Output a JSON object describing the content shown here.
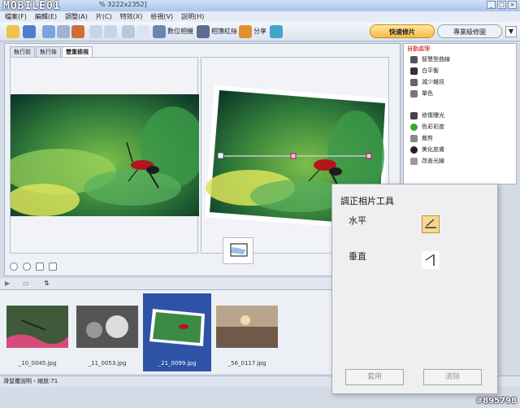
{
  "window": {
    "logo": "MOBILE01",
    "title_fragment": "% 3222x2352]",
    "controls": [
      "_",
      "□",
      "×"
    ]
  },
  "menu": [
    "檔案(F)",
    "編輯(E)",
    "調整(A)",
    "片(C)",
    "特效(X)",
    "檢視(V)",
    "說明(H)"
  ],
  "toolbar": {
    "buttons": [
      "數位相機",
      "相簿紅絲",
      "分享"
    ],
    "mode_tabs": [
      "快速修片",
      "專業級修圖"
    ],
    "active_mode": "快速修片"
  },
  "view_tabs": [
    "執行前",
    "執行後",
    "雙重檢視"
  ],
  "active_view_tab": "雙重檢視",
  "side_panel": {
    "header": "自動處理",
    "items": [
      "智慧型曲線",
      "白平衡",
      "減少雜訊",
      "單色",
      "修復曝光",
      "色彩彩度",
      "裁剪",
      "美化皮膚",
      "改善光線"
    ]
  },
  "thumbnails": [
    {
      "caption": "_10_0045.jpg",
      "selected": false
    },
    {
      "caption": "_11_0053.jpg",
      "selected": false
    },
    {
      "caption": "_21_0099.jpg",
      "selected": true
    },
    {
      "caption": "_56_0117.jpg",
      "selected": false
    }
  ],
  "status": "滑鼠覆說明・縮放:71",
  "popup": {
    "title": "調正相片工具",
    "horizontal_label": "水平",
    "vertical_label": "垂直",
    "apply_button": "套用",
    "clear_button": "清除"
  },
  "watermark": "#895798"
}
